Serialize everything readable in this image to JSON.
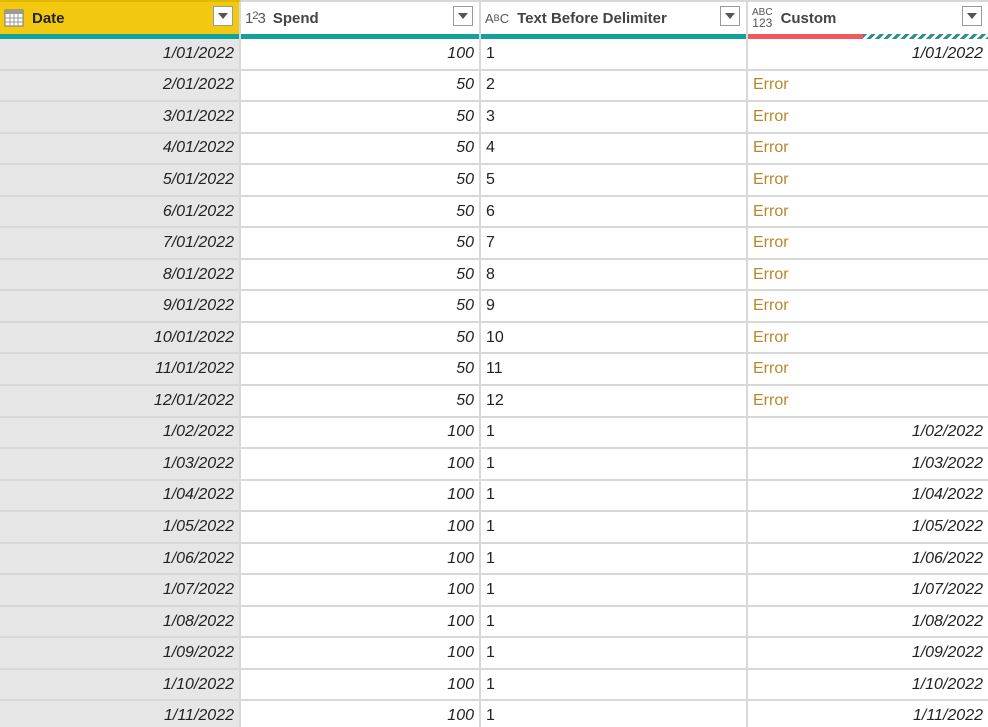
{
  "columns": [
    {
      "key": "date",
      "label": "Date",
      "type_icon": "calendar-icon",
      "selected": true
    },
    {
      "key": "spend",
      "label": "Spend",
      "type_icon": "number-type-icon",
      "type_text": "1²3"
    },
    {
      "key": "text",
      "label": "Text Before Delimiter",
      "type_icon": "text-type-icon",
      "type_text": "ABC"
    },
    {
      "key": "custom",
      "label": "Custom",
      "type_icon": "any-type-icon",
      "type_text_top": "ABC",
      "type_text_bottom": "123"
    }
  ],
  "rows": [
    {
      "date": "1/01/2022",
      "spend": "100",
      "text": "1",
      "custom": "1/01/2022",
      "custom_error": false
    },
    {
      "date": "2/01/2022",
      "spend": "50",
      "text": "2",
      "custom": "Error",
      "custom_error": true
    },
    {
      "date": "3/01/2022",
      "spend": "50",
      "text": "3",
      "custom": "Error",
      "custom_error": true
    },
    {
      "date": "4/01/2022",
      "spend": "50",
      "text": "4",
      "custom": "Error",
      "custom_error": true
    },
    {
      "date": "5/01/2022",
      "spend": "50",
      "text": "5",
      "custom": "Error",
      "custom_error": true
    },
    {
      "date": "6/01/2022",
      "spend": "50",
      "text": "6",
      "custom": "Error",
      "custom_error": true
    },
    {
      "date": "7/01/2022",
      "spend": "50",
      "text": "7",
      "custom": "Error",
      "custom_error": true
    },
    {
      "date": "8/01/2022",
      "spend": "50",
      "text": "8",
      "custom": "Error",
      "custom_error": true
    },
    {
      "date": "9/01/2022",
      "spend": "50",
      "text": "9",
      "custom": "Error",
      "custom_error": true
    },
    {
      "date": "10/01/2022",
      "spend": "50",
      "text": "10",
      "custom": "Error",
      "custom_error": true
    },
    {
      "date": "11/01/2022",
      "spend": "50",
      "text": "11",
      "custom": "Error",
      "custom_error": true
    },
    {
      "date": "12/01/2022",
      "spend": "50",
      "text": "12",
      "custom": "Error",
      "custom_error": true
    },
    {
      "date": "1/02/2022",
      "spend": "100",
      "text": "1",
      "custom": "1/02/2022",
      "custom_error": false
    },
    {
      "date": "1/03/2022",
      "spend": "100",
      "text": "1",
      "custom": "1/03/2022",
      "custom_error": false
    },
    {
      "date": "1/04/2022",
      "spend": "100",
      "text": "1",
      "custom": "1/04/2022",
      "custom_error": false
    },
    {
      "date": "1/05/2022",
      "spend": "100",
      "text": "1",
      "custom": "1/05/2022",
      "custom_error": false
    },
    {
      "date": "1/06/2022",
      "spend": "100",
      "text": "1",
      "custom": "1/06/2022",
      "custom_error": false
    },
    {
      "date": "1/07/2022",
      "spend": "100",
      "text": "1",
      "custom": "1/07/2022",
      "custom_error": false
    },
    {
      "date": "1/08/2022",
      "spend": "100",
      "text": "1",
      "custom": "1/08/2022",
      "custom_error": false
    },
    {
      "date": "1/09/2022",
      "spend": "100",
      "text": "1",
      "custom": "1/09/2022",
      "custom_error": false
    },
    {
      "date": "1/10/2022",
      "spend": "100",
      "text": "1",
      "custom": "1/10/2022",
      "custom_error": false
    },
    {
      "date": "1/11/2022",
      "spend": "100",
      "text": "1",
      "custom": "1/11/2022",
      "custom_error": false
    }
  ],
  "colors": {
    "selected_header": "#f2c811",
    "valid_bar": "#11a29a",
    "error_bar": "#f1595c",
    "error_text": "#b8872a",
    "date_column_bg": "#e6e6e6"
  }
}
